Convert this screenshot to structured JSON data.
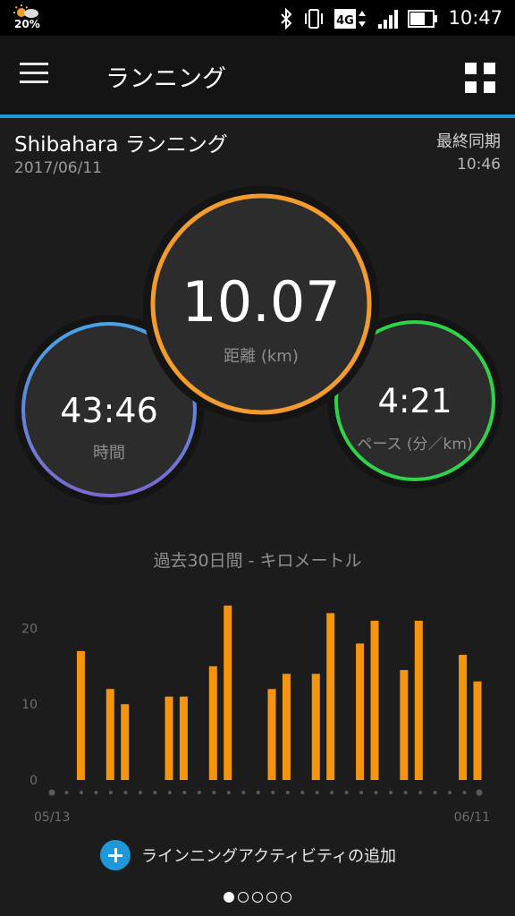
{
  "status_bar": {
    "temperature": "20%",
    "network": "4G",
    "time": "10:47",
    "icons": [
      "weather-icon",
      "bluetooth-icon",
      "vibrate-icon",
      "signal-icon",
      "battery-icon"
    ]
  },
  "app_bar": {
    "title": "ランニング",
    "menu_icon": "hamburger-menu-icon",
    "grid_icon": "grid-view-icon"
  },
  "activity": {
    "name": "Shibahara ランニング",
    "date": "2017/06/11",
    "sync_label": "最終同期",
    "sync_time": "10:46"
  },
  "metrics": {
    "distance": {
      "value": "10.07",
      "label": "距離 (km)",
      "color": "#f29c2f"
    },
    "time": {
      "value": "43:46",
      "label": "時間",
      "color_start": "#4aa3e6",
      "color_end": "#7a6ad0"
    },
    "pace": {
      "value": "4:21",
      "label": "ペース (分／km)",
      "color": "#2fd34a"
    }
  },
  "chart_title": "過去30日間 - キロメートル",
  "chart_data": {
    "type": "bar",
    "y_ticks": [
      "0",
      "10",
      "20"
    ],
    "ylim": [
      0,
      25
    ],
    "x_labels": [
      "05/13",
      "06/11"
    ],
    "days": 30,
    "values": [
      0,
      17,
      0,
      12,
      10,
      0,
      0,
      11,
      11,
      0,
      15,
      23,
      0,
      0,
      12,
      14,
      0,
      14,
      22,
      0,
      18,
      21,
      0,
      14.5,
      21,
      0,
      0,
      16.5,
      13
    ],
    "bar_color": "#f5940f"
  },
  "add_activity": {
    "label": "ラインニングアクティビティの追加",
    "icon": "add-circle-icon"
  },
  "pager": {
    "pages": 5,
    "active": 0
  }
}
